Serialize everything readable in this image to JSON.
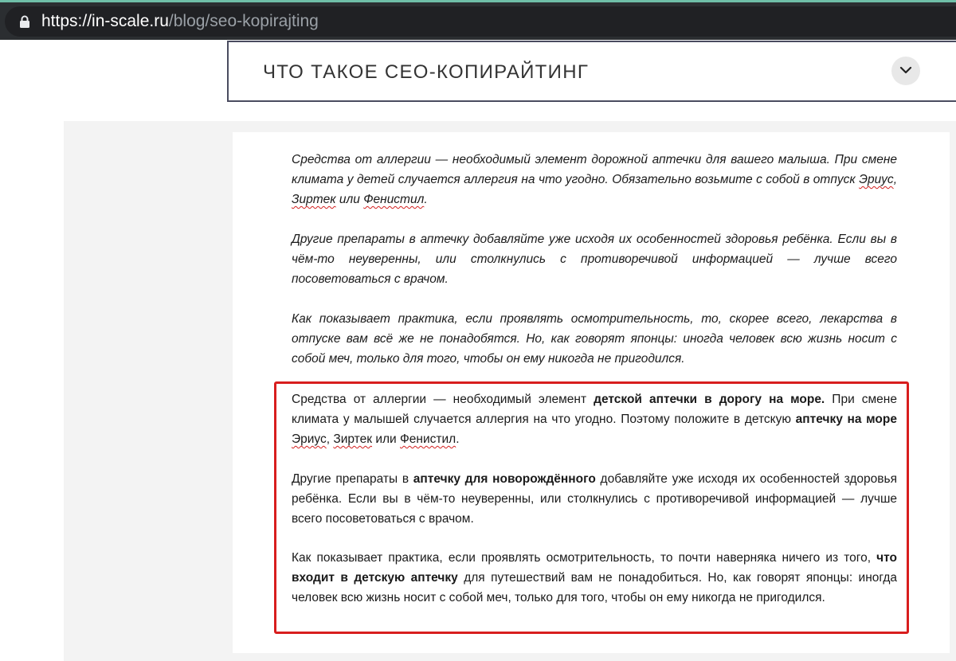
{
  "browser": {
    "url_host": "https://in-scale.ru",
    "url_path": "/blog/seo-kopirajting"
  },
  "accordion": {
    "title": "ЧТО ТАКОЕ СЕО-КОПИРАЙТИНГ"
  },
  "original_text": {
    "p1": {
      "t1": "Средства от аллергии — необходимый элемент дорожной аптечки для вашего малыша. При смене климата у детей случается  аллергия на что угодно. Обязательно возьмите с собой в отпуск ",
      "drug1": "Эриус",
      "t2": ", ",
      "drug2": "Зиртек",
      "t3": " или ",
      "drug3": "Фенистил",
      "t4": "."
    },
    "p2": "Другие препараты в аптечку добавляйте уже исходя их особенностей здоровья ребёнка. Если вы в чём-то неуверенны, или столкнулись с противоречивой информацией — лучше всего посоветоваться с врачом.",
    "p3": "Как показывает практика, если проявлять осмотрительность, то, скорее всего, лекарства в отпуске вам всё же не понадобятся.  Но, как говорят японцы: иногда человек всю жизнь носит с собой меч, только для того, чтобы он ему никогда не пригодился."
  },
  "rewritten_text": {
    "p1": {
      "t1": "Средства от аллергии — необходимый элемент ",
      "kw1": "детской аптечки в дорогу на море.",
      "t2": " При смене климата у малышей случается аллергия на что угодно. Поэтому положите в детскую ",
      "kw2": "аптечку на море",
      "t3": " ",
      "drug1": "Эриус",
      "t4": ", ",
      "drug2": "Зиртек",
      "t5": " или ",
      "drug3": "Фенистил",
      "t6": "."
    },
    "p2": {
      "t1": "Другие препараты в ",
      "kw1": "аптечку для новорождённого",
      "t2": " добавляйте уже исходя их особенностей здоровья ребёнка. Если вы в чём-то неуверенны, или столкнулись с противоречивой информацией — лучше всего посоветоваться с врачом."
    },
    "p3": {
      "t1": "Как показывает практика, если проявлять осмотрительность, то почти наверняка ничего из того, ",
      "kw1": "что входит в детскую аптечку",
      "t2": " для путешествий вам не понадобиться.  Но, как говорят японцы: иногда человек всю жизнь носит с собой меч, только для того, чтобы он ему никогда не пригодился."
    }
  },
  "icons": {
    "lock": "lock-icon",
    "toggle": "chevron-down-icon"
  },
  "colors": {
    "highlight_border": "#d81e1e",
    "spellcheck_underline": "#d32020",
    "accordion_border": "#4a4c60"
  }
}
